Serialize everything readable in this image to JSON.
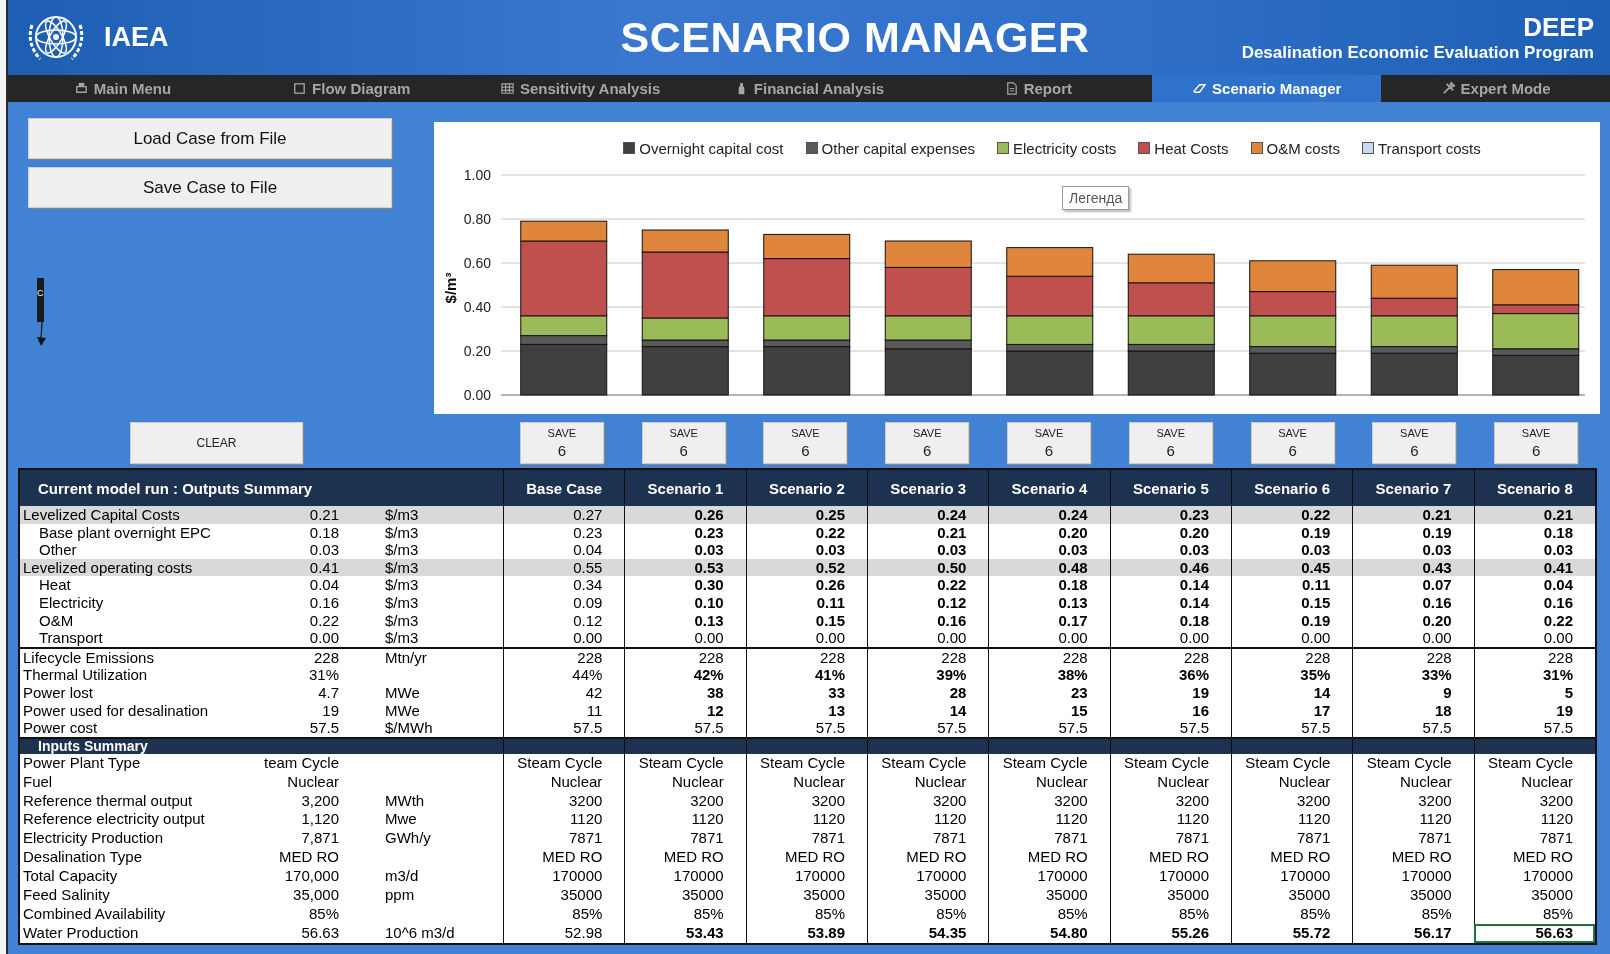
{
  "header": {
    "org": "IAEA",
    "title": "SCENARIO MANAGER",
    "product": "DEEP",
    "subtitle": "Desalination Economic Evaluation Program"
  },
  "tabs": [
    {
      "label": "Main Menu",
      "selected": false
    },
    {
      "label": "Flow Diagram",
      "selected": false
    },
    {
      "label": "Sensitivity Analysis",
      "selected": false
    },
    {
      "label": "Financial Analysis",
      "selected": false
    },
    {
      "label": "Report",
      "selected": false
    },
    {
      "label": "Scenario Manager",
      "selected": true
    },
    {
      "label": "Expert Mode",
      "selected": false
    }
  ],
  "buttons": {
    "load": "Load Case from File",
    "save": "Save Case to File",
    "clear": "CLEAR"
  },
  "marker": {
    "text": "C"
  },
  "chart": {
    "tooltip": "Легенда",
    "chart_data": {
      "type": "bar",
      "stacked": true,
      "grid": true,
      "legend": true,
      "ylabel": "$/m³",
      "ylim": [
        0,
        1
      ],
      "yticks": [
        {
          "value": 0,
          "label": "0.00"
        },
        {
          "value": 0.2,
          "label": "0.20"
        },
        {
          "value": 0.4,
          "label": "0.40"
        },
        {
          "value": 0.6,
          "label": "0.60"
        },
        {
          "value": 0.8,
          "label": "0.80"
        },
        {
          "value": 1,
          "label": "1.00"
        }
      ],
      "series": [
        {
          "name": "Overnight capital cost",
          "color": "#404040",
          "values": [
            0.23,
            0.22,
            0.22,
            0.21,
            0.2,
            0.2,
            0.19,
            0.19,
            0.18
          ]
        },
        {
          "name": "Other capital expenses",
          "color": "#595959",
          "values": [
            0.04,
            0.03,
            0.03,
            0.04,
            0.03,
            0.03,
            0.03,
            0.03,
            0.03
          ]
        },
        {
          "name": "Electricity costs",
          "color": "#9bbb59",
          "values": [
            0.09,
            0.1,
            0.11,
            0.11,
            0.13,
            0.13,
            0.14,
            0.14,
            0.16
          ]
        },
        {
          "name": "Heat Costs",
          "color": "#c0504d",
          "values": [
            0.34,
            0.3,
            0.26,
            0.22,
            0.18,
            0.15,
            0.11,
            0.08,
            0.04
          ]
        },
        {
          "name": "O&M costs",
          "color": "#e0863c",
          "values": [
            0.09,
            0.1,
            0.11,
            0.12,
            0.13,
            0.13,
            0.14,
            0.15,
            0.16
          ]
        },
        {
          "name": "Transport costs",
          "color": "#c6d9f1",
          "values": [
            0,
            0,
            0,
            0,
            0,
            0,
            0,
            0,
            0
          ]
        }
      ]
    }
  },
  "save_buttons": [
    {
      "label": "SAVE",
      "count": "6"
    },
    {
      "label": "SAVE",
      "count": "6"
    },
    {
      "label": "SAVE",
      "count": "6"
    },
    {
      "label": "SAVE",
      "count": "6"
    },
    {
      "label": "SAVE",
      "count": "6"
    },
    {
      "label": "SAVE",
      "count": "6"
    },
    {
      "label": "SAVE",
      "count": "6"
    },
    {
      "label": "SAVE",
      "count": "6"
    },
    {
      "label": "SAVE",
      "count": "6"
    }
  ],
  "table": {
    "title": "Current model run : Outputs Summary",
    "columns": [
      "Base Case",
      "Scenario 1",
      "Scenario 2",
      "Scenario 3",
      "Scenario 4",
      "Scenario 5",
      "Scenario 6",
      "Scenario 7",
      "Scenario 8"
    ],
    "output_groups": [
      {
        "rows": [
          {
            "kind": "group",
            "label": "Levelized Capital Costs",
            "value": "0.21",
            "unit": "$/m3",
            "bold": true,
            "values": [
              "0.27",
              "0.26",
              "0.25",
              "0.24",
              "0.24",
              "0.23",
              "0.22",
              "0.21",
              "0.21"
            ]
          },
          {
            "kind": "sub",
            "label": "Base plant overnight EPC",
            "value": "0.18",
            "unit": "$/m3",
            "bold": true,
            "values": [
              "0.23",
              "0.23",
              "0.22",
              "0.21",
              "0.20",
              "0.20",
              "0.19",
              "0.19",
              "0.18"
            ]
          },
          {
            "kind": "sub",
            "label": "Other",
            "value": "0.03",
            "unit": "$/m3",
            "bold": true,
            "values": [
              "0.04",
              "0.03",
              "0.03",
              "0.03",
              "0.03",
              "0.03",
              "0.03",
              "0.03",
              "0.03"
            ]
          },
          {
            "kind": "group",
            "label": "Levelized operating costs",
            "value": "0.41",
            "unit": "$/m3",
            "bold": true,
            "values": [
              "0.55",
              "0.53",
              "0.52",
              "0.50",
              "0.48",
              "0.46",
              "0.45",
              "0.43",
              "0.41"
            ]
          },
          {
            "kind": "sub",
            "label": "Heat",
            "value": "0.04",
            "unit": "$/m3",
            "bold": true,
            "values": [
              "0.34",
              "0.30",
              "0.26",
              "0.22",
              "0.18",
              "0.14",
              "0.11",
              "0.07",
              "0.04"
            ]
          },
          {
            "kind": "sub",
            "label": "Electricity",
            "value": "0.16",
            "unit": "$/m3",
            "bold": true,
            "values": [
              "0.09",
              "0.10",
              "0.11",
              "0.12",
              "0.13",
              "0.14",
              "0.15",
              "0.16",
              "0.16"
            ]
          },
          {
            "kind": "sub",
            "label": "O&M",
            "value": "0.22",
            "unit": "$/m3",
            "bold": true,
            "values": [
              "0.12",
              "0.13",
              "0.15",
              "0.16",
              "0.17",
              "0.18",
              "0.19",
              "0.20",
              "0.22"
            ]
          },
          {
            "kind": "sub",
            "label": "Transport",
            "value": "0.00",
            "unit": "$/m3",
            "bold": false,
            "values": [
              "0.00",
              "0.00",
              "0.00",
              "0.00",
              "0.00",
              "0.00",
              "0.00",
              "0.00",
              "0.00"
            ]
          }
        ]
      },
      {
        "rows": [
          {
            "kind": "plain",
            "label": "Lifecycle Emissions",
            "value": "228",
            "unit": "Mtn/yr",
            "bold": false,
            "values": [
              "228",
              "228",
              "228",
              "228",
              "228",
              "228",
              "228",
              "228",
              "228"
            ]
          },
          {
            "kind": "plain",
            "label": "Thermal Utilization",
            "value": "31%",
            "bold": true,
            "values": [
              "44%",
              "42%",
              "41%",
              "39%",
              "38%",
              "36%",
              "35%",
              "33%",
              "31%"
            ]
          },
          {
            "kind": "plain",
            "label": "Power lost",
            "value": "4.7",
            "unit": "MWe",
            "bold": true,
            "values": [
              "42",
              "38",
              "33",
              "28",
              "23",
              "19",
              "14",
              "9",
              "5"
            ]
          },
          {
            "kind": "plain",
            "label": "Power used for desalination",
            "value": "19",
            "unit": "MWe",
            "bold": true,
            "values": [
              "11",
              "12",
              "13",
              "14",
              "15",
              "16",
              "17",
              "18",
              "19"
            ]
          },
          {
            "kind": "plain",
            "label": "Power cost",
            "value": "57.5",
            "unit": "$/MWh",
            "bold": false,
            "values": [
              "57.5",
              "57.5",
              "57.5",
              "57.5",
              "57.5",
              "57.5",
              "57.5",
              "57.5",
              "57.5"
            ]
          }
        ]
      }
    ],
    "inputs_title": "Inputs Summary",
    "input_rows": [
      {
        "kind": "plain",
        "label": "Power Plant Type",
        "value": "team Cycle",
        "bold": false,
        "values": [
          "Steam Cycle",
          "Steam Cycle",
          "Steam Cycle",
          "Steam Cycle",
          "Steam Cycle",
          "Steam Cycle",
          "Steam Cycle",
          "Steam Cycle",
          "Steam Cycle"
        ]
      },
      {
        "kind": "plain",
        "label": "Fuel",
        "value": "Nuclear",
        "bold": false,
        "values": [
          "Nuclear",
          "Nuclear",
          "Nuclear",
          "Nuclear",
          "Nuclear",
          "Nuclear",
          "Nuclear",
          "Nuclear",
          "Nuclear"
        ]
      },
      {
        "kind": "plain",
        "label": "Reference thermal output",
        "value": "3,200",
        "unit": "MWth",
        "bold": false,
        "values": [
          "3200",
          "3200",
          "3200",
          "3200",
          "3200",
          "3200",
          "3200",
          "3200",
          "3200"
        ]
      },
      {
        "kind": "plain",
        "label": "Reference electricity output",
        "value": "1,120",
        "unit": "Mwe",
        "bold": false,
        "values": [
          "1120",
          "1120",
          "1120",
          "1120",
          "1120",
          "1120",
          "1120",
          "1120",
          "1120"
        ]
      },
      {
        "kind": "plain",
        "label": "Electricity Production",
        "value": "7,871",
        "unit": "GWh/y",
        "bold": false,
        "values": [
          "7871",
          "7871",
          "7871",
          "7871",
          "7871",
          "7871",
          "7871",
          "7871",
          "7871"
        ]
      },
      {
        "kind": "plain",
        "label": "Desalination Type",
        "value": "MED RO",
        "bold": false,
        "values": [
          "MED RO",
          "MED RO",
          "MED RO",
          "MED RO",
          "MED RO",
          "MED RO",
          "MED RO",
          "MED RO",
          "MED RO"
        ]
      },
      {
        "kind": "plain",
        "label": "Total Capacity",
        "value": "170,000",
        "unit": "m3/d",
        "bold": false,
        "values": [
          "170000",
          "170000",
          "170000",
          "170000",
          "170000",
          "170000",
          "170000",
          "170000",
          "170000"
        ]
      },
      {
        "kind": "plain",
        "label": "Feed Salinity",
        "value": "35,000",
        "unit": "ppm",
        "bold": false,
        "values": [
          "35000",
          "35000",
          "35000",
          "35000",
          "35000",
          "35000",
          "35000",
          "35000",
          "35000"
        ]
      },
      {
        "kind": "plain",
        "label": "Combined Availability",
        "value": "85%",
        "bold": false,
        "values": [
          "85%",
          "85%",
          "85%",
          "85%",
          "85%",
          "85%",
          "85%",
          "85%",
          "85%"
        ]
      },
      {
        "kind": "plain",
        "label": "Water Production",
        "value": "56.63",
        "unit": "10^6 m3/d",
        "bold": true,
        "values": [
          {
            "text": "52.98",
            "selected": false
          },
          {
            "text": "53.43",
            "selected": false
          },
          {
            "text": "53.89",
            "selected": false
          },
          {
            "text": "54.35",
            "selected": false
          },
          {
            "text": "54.80",
            "selected": false
          },
          {
            "text": "55.26",
            "selected": false
          },
          {
            "text": "55.72",
            "selected": false
          },
          {
            "text": "56.17",
            "selected": false
          },
          {
            "text": "56.63",
            "selected": true
          }
        ]
      }
    ]
  }
}
